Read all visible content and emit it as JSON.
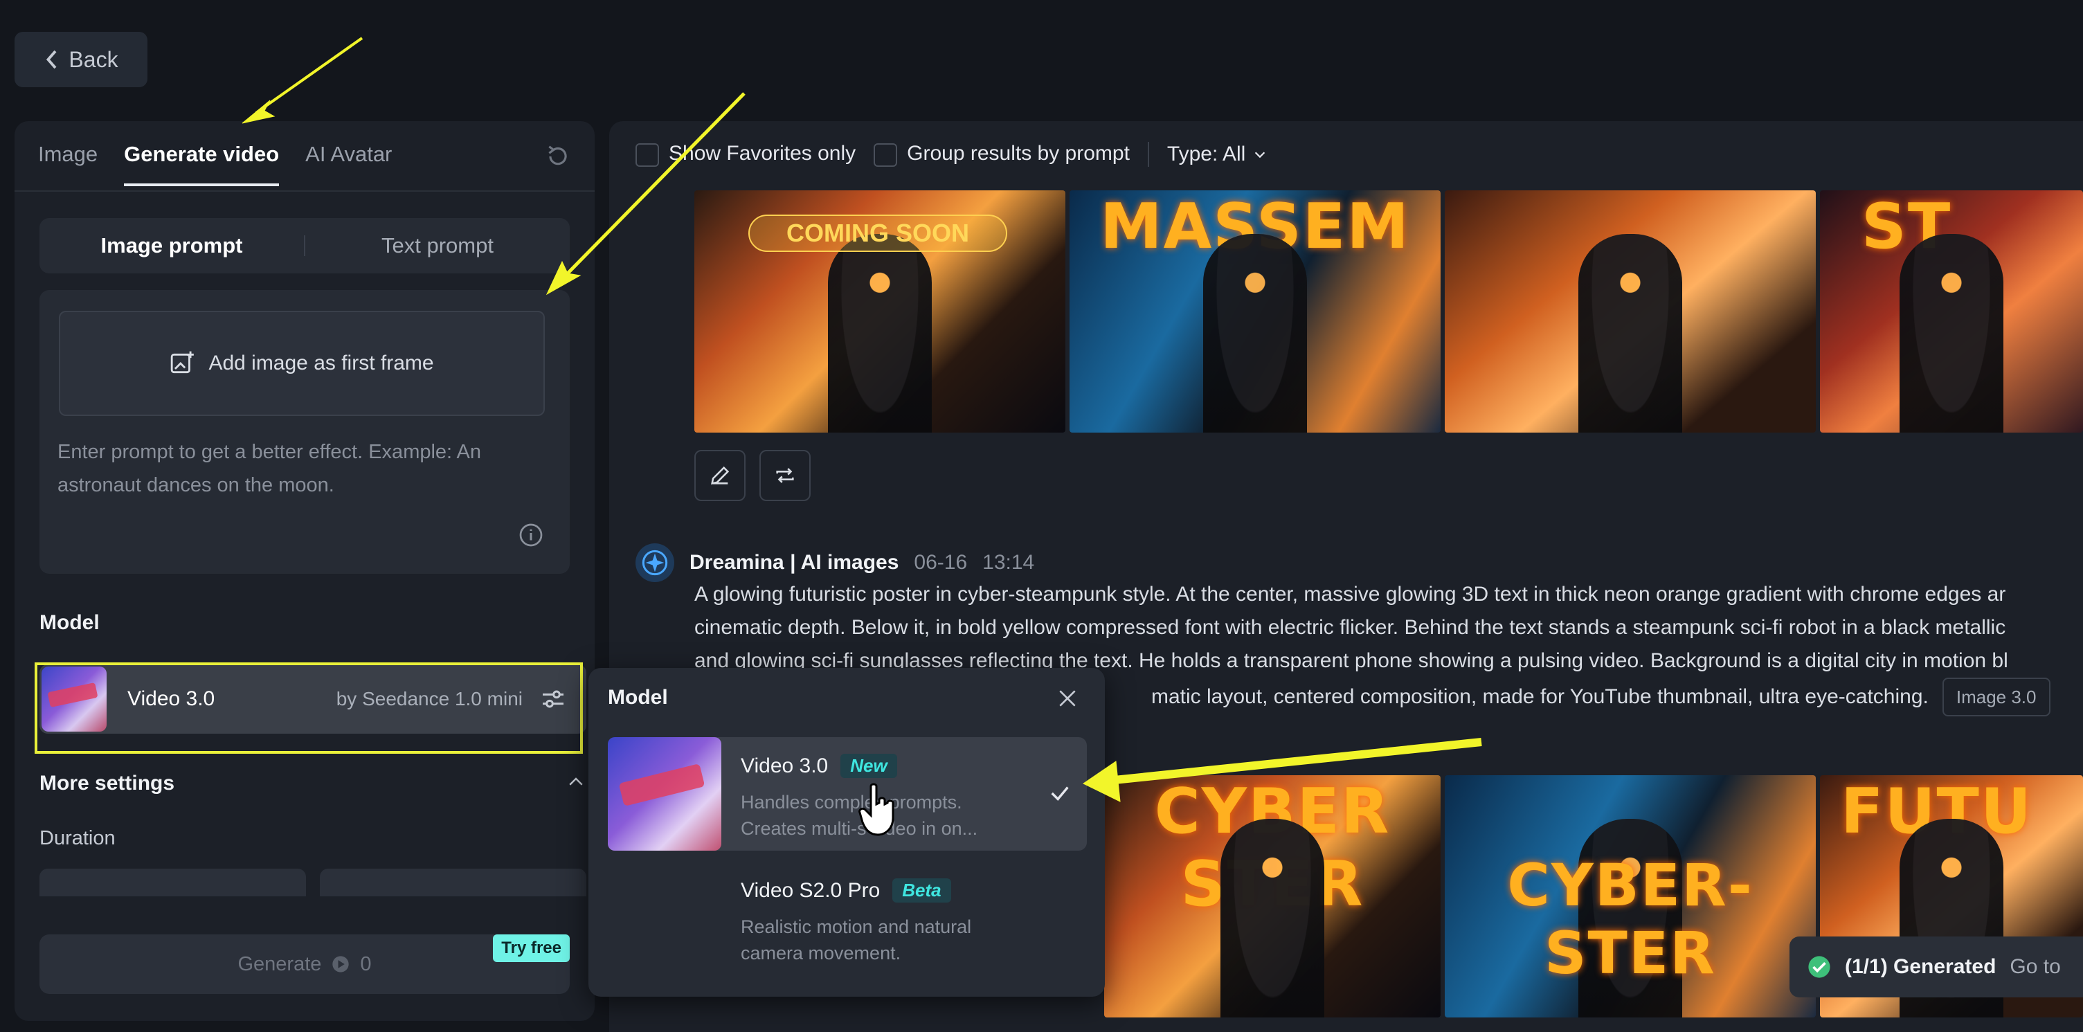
{
  "back": {
    "label": "Back"
  },
  "left": {
    "tabs": [
      {
        "label": "Image"
      },
      {
        "label": "Generate video"
      },
      {
        "label": "AI Avatar"
      }
    ],
    "prompt_modes": {
      "image": "Image prompt",
      "text": "Text prompt"
    },
    "add_frame_label": "Add image as first frame",
    "prompt_placeholder": "Enter prompt to get a better effect. Example: An astronaut dances on the moon.",
    "model_label": "Model",
    "model": {
      "name": "Video 3.0",
      "by": "by Seedance 1.0 mini"
    },
    "more_settings": "More settings",
    "duration_label": "Duration",
    "generate": {
      "label": "Generate",
      "credits": "0",
      "try_free": "Try free"
    }
  },
  "filters": {
    "favorites": "Show Favorites only",
    "group": "Group results by prompt",
    "type": "Type: All"
  },
  "thumbnails_top": [
    {
      "overlay": "COMING SOON"
    },
    {
      "overlay": "MASSEM"
    },
    {
      "overlay": ""
    },
    {
      "overlay": "ST"
    }
  ],
  "post": {
    "author": "Dreamina | AI images",
    "date": "06-16",
    "time": "13:14",
    "lines": [
      "A glowing futuristic poster in cyber-steampunk style. At the center, massive glowing 3D text in thick neon orange gradient with chrome edges ar",
      "cinematic depth. Below it, in bold yellow compressed font with electric flicker. Behind the text stands a steampunk sci-fi robot in a black metallic",
      "and glowing sci-fi sunglasses reflecting the text. He holds a transparent phone showing a pulsing video. Background is a digital city in motion bl",
      "matic layout, centered composition, made for YouTube thumbnail, ultra eye-catching."
    ],
    "tag": "Image 3.0"
  },
  "thumbnails_bottom": [
    {
      "overlay": "CYBER STER"
    },
    {
      "overlay": "CYBER-STER"
    },
    {
      "overlay": "FUTU"
    }
  ],
  "popup": {
    "title": "Model",
    "options": [
      {
        "name": "Video 3.0",
        "badge": "New",
        "desc1": "Handles complex prompts.",
        "desc2": "Creates multi-s video in on...",
        "selected": true
      },
      {
        "name": "Video S2.0 Pro",
        "badge": "Beta",
        "desc1": "Realistic motion and natural",
        "desc2": "camera movement.",
        "selected": false
      }
    ]
  },
  "toast": {
    "text": "(1/1) Generated",
    "link": "Go to"
  },
  "colors": {
    "accent_yellow": "#e9f03a",
    "badge_cyan": "#3fe6e0",
    "try_free_bg": "#6ff2e6"
  }
}
